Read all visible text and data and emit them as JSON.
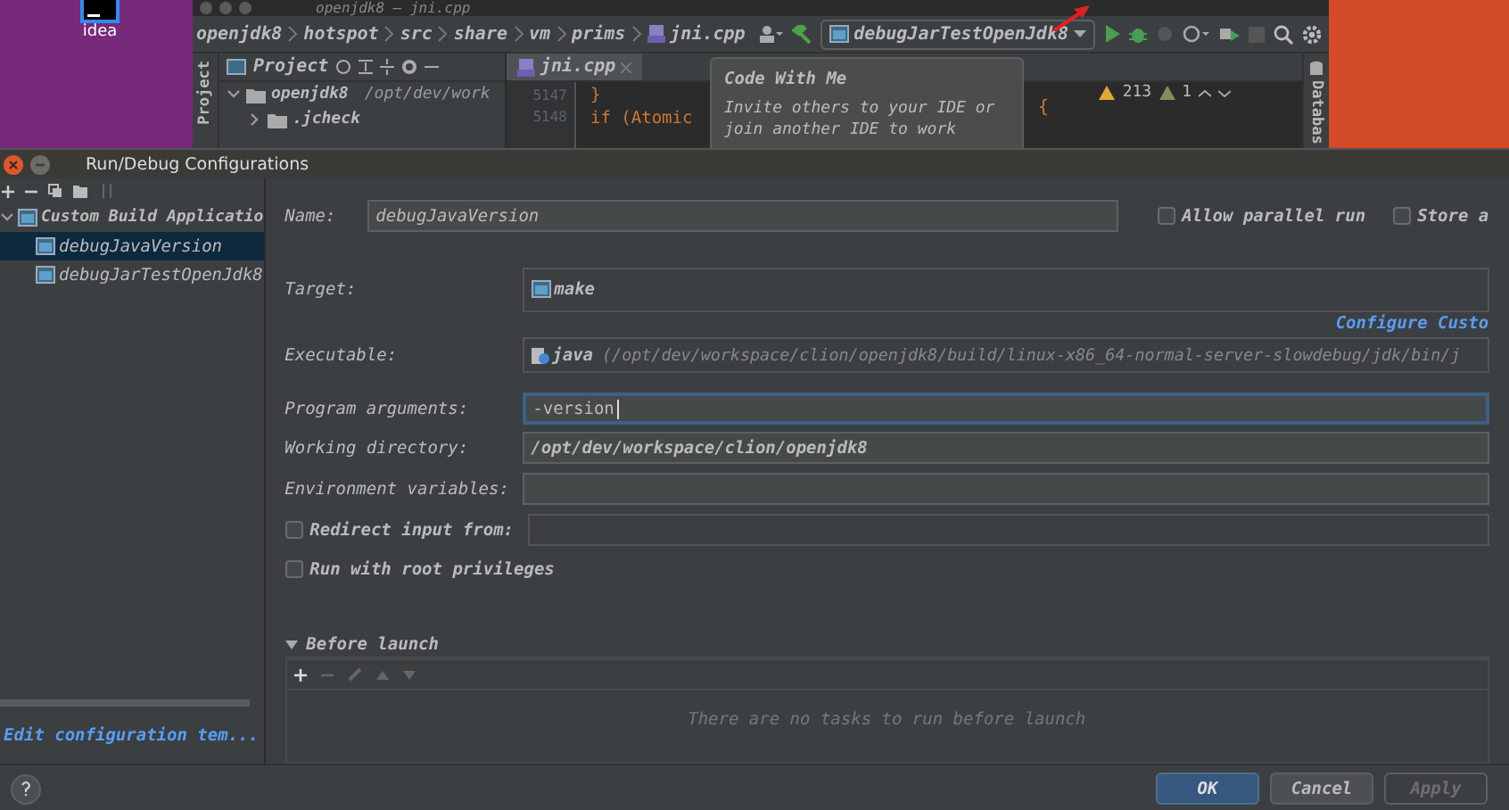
{
  "desktop": {
    "icon_label": "idea"
  },
  "ide": {
    "title": "openjdk8 – jni.cpp",
    "breadcrumbs": [
      "openjdk8",
      "hotspot",
      "src",
      "share",
      "vm",
      "prims",
      "jni.cpp"
    ],
    "run_config": "debugJarTestOpenJdk8",
    "side_label": "Project",
    "project_header": "Project",
    "tree": [
      {
        "name": "openjdk8",
        "path": "/opt/dev/work",
        "expanded": true,
        "children": [
          {
            "name": ".jcheck",
            "expanded": false
          }
        ]
      }
    ],
    "editor_tab": "jni.cpp",
    "line_numbers": [
      "5147",
      "5148"
    ],
    "code_lines": [
      "}",
      "if (Atomic"
    ],
    "code_tail": "{",
    "warnings": "213",
    "weak_warnings": "1",
    "database_label": "Databas",
    "tooltip": {
      "title": "Code With Me",
      "text": "Invite others to your IDE or join another IDE to work"
    }
  },
  "dialog": {
    "title": "Run/Debug Configurations",
    "tree": [
      {
        "name": "Custom Build Applicatio",
        "expanded": true,
        "children": [
          {
            "name": "debugJavaVersion",
            "selected": true
          },
          {
            "name": "debugJarTestOpenJdk8",
            "selected": false
          }
        ]
      }
    ],
    "templates_link": "Edit configuration tem...",
    "name_label": "Name:",
    "name_value": "debugJavaVersion",
    "options": [
      {
        "label": "Allow parallel run",
        "checked": false
      },
      {
        "label": "Store a",
        "checked": false
      }
    ],
    "rows": [
      {
        "kind": "select",
        "label": "Target:",
        "value": "make"
      },
      {
        "kind": "link",
        "text": "Configure Custo"
      },
      {
        "kind": "executable",
        "label": "Executable:",
        "value": "java",
        "detail": "(/opt/dev/workspace/clion/openjdk8/build/linux-x86_64-normal-server-slowdebug/jdk/bin/j"
      },
      {
        "kind": "text",
        "label": "Program arguments:",
        "value": "-version",
        "focused": true
      },
      {
        "kind": "text",
        "label": "Working directory:",
        "value": "/opt/dev/workspace/clion/openjdk8",
        "focused": false
      },
      {
        "kind": "text",
        "label": "Environment variables:",
        "focused": false
      },
      {
        "kind": "checkfield",
        "label": "Redirect input from:",
        "checked": false
      },
      {
        "kind": "check",
        "label": "Run with root privileges",
        "checked": false
      }
    ],
    "before_launch": {
      "title": "Before launch",
      "expanded": true,
      "empty_text": "There are no tasks to run before launch"
    },
    "buttons": [
      {
        "label": "OK",
        "kind": "primary",
        "disabled": false
      },
      {
        "label": "Cancel",
        "kind": "normal",
        "disabled": false
      },
      {
        "label": "Apply",
        "kind": "normal",
        "disabled": true
      }
    ]
  }
}
